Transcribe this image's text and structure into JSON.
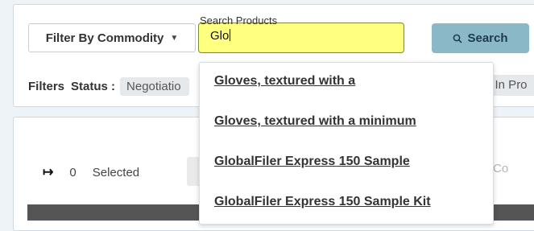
{
  "toolbar": {
    "filter_label": "Filter By Commodity",
    "search_legend": "Search Products",
    "search_value": "Glo",
    "search_button": "Search"
  },
  "filters": {
    "label": "Filters",
    "status_label": "Status :",
    "status_value": "Negotiatio",
    "status_value_right": "e In Pro"
  },
  "selection": {
    "count": "0",
    "label": "Selected",
    "right_button": "Co"
  },
  "suggestions": [
    "Gloves, textured with a",
    "Gloves, textured with a minimum",
    "GlobalFiler Express 150 Sample",
    "GlobalFiler Express 150 Sample Kit"
  ]
}
